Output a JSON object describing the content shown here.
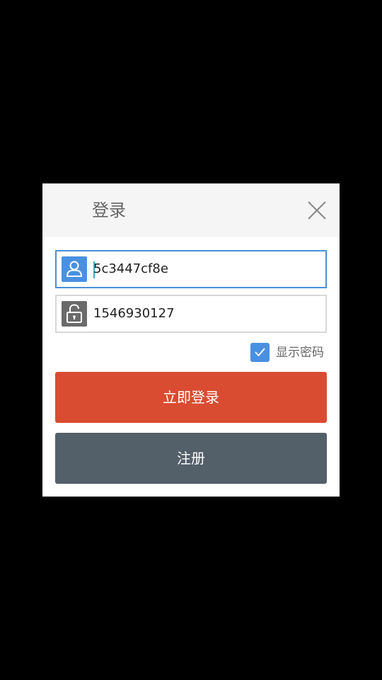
{
  "dialog": {
    "title": "登录",
    "close_icon": "close-icon"
  },
  "username": {
    "icon": "user-icon",
    "value": "5c3447cf8e"
  },
  "password": {
    "icon": "unlock-icon",
    "value": "1546930127"
  },
  "show_password": {
    "checked": true,
    "label": "显示密码"
  },
  "buttons": {
    "login_label": "立即登录",
    "register_label": "注册"
  },
  "colors": {
    "accent_blue": "#4a90e2",
    "login_red": "#d94c31",
    "register_gray": "#535f69",
    "backdrop": "#000000"
  }
}
